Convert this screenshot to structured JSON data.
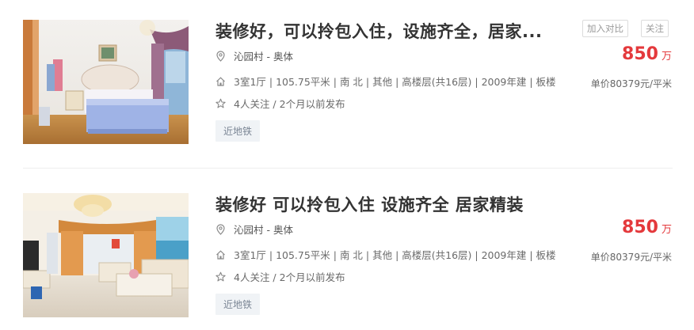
{
  "listings": [
    {
      "title": "装修好，可以拎包入住，设施齐全，居家...",
      "location": "沁园村 - 奥体",
      "house_info": "3室1厅 | 105.75平米 | 南 北 | 其他 | 高楼层(共16层) | 2009年建 | 板楼",
      "follow_info": "4人关注 / 2个月以前发布",
      "tag": "近地铁",
      "compare_label": "加入对比",
      "follow_label": "关注",
      "price": "850",
      "price_unit": "万",
      "unit_price": "单价80379元/平米",
      "location_icon": "location-pin-icon",
      "house_icon": "house-icon",
      "star_icon": "star-icon"
    },
    {
      "title": "装修好 可以拎包入住 设施齐全 居家精装",
      "location": "沁园村 - 奥体",
      "house_info": "3室1厅 | 105.75平米 | 南 北 | 其他 | 高楼层(共16层) | 2009年建 | 板楼",
      "follow_info": "4人关注 / 2个月以前发布",
      "tag": "近地铁",
      "price": "850",
      "price_unit": "万",
      "unit_price": "单价80379元/平米",
      "location_icon": "location-pin-icon",
      "house_icon": "house-icon",
      "star_icon": "star-icon"
    }
  ],
  "colors": {
    "price": "#e4393c",
    "title": "#333333",
    "tag_bg": "#f0f3f6"
  }
}
